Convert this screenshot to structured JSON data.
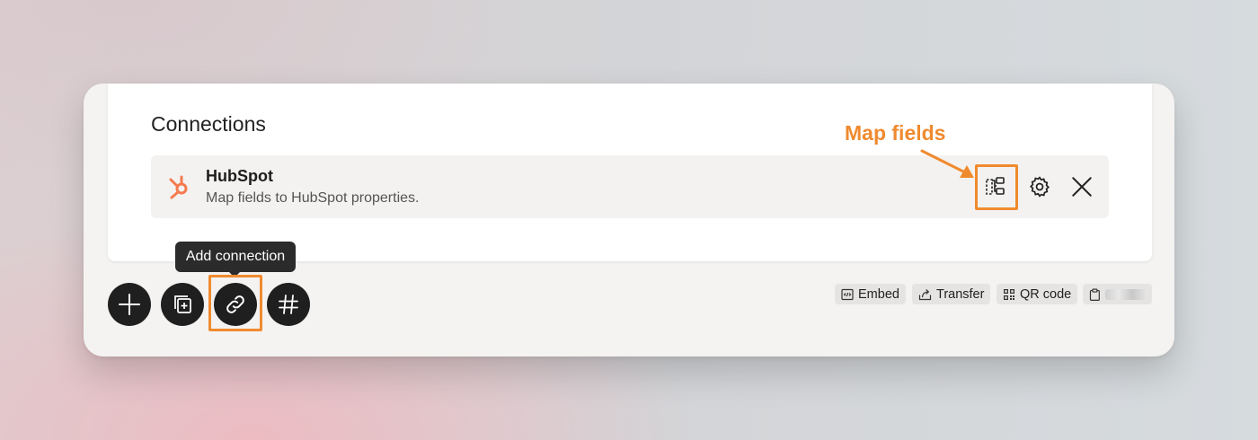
{
  "section": {
    "title": "Connections"
  },
  "connection": {
    "name": "HubSpot",
    "description": "Map fields to HubSpot properties.",
    "icon": "hubspot-logo-icon",
    "brand_color": "#f57b4f",
    "actions": {
      "map_fields_icon": "map-fields-icon",
      "settings_icon": "gear-icon",
      "remove_icon": "close-icon"
    }
  },
  "annotation": {
    "label": "Map fields",
    "color": "#f08a2f"
  },
  "tooltip": {
    "label": "Add connection"
  },
  "toolbar": {
    "buttons": [
      "plus-icon",
      "duplicate-icon",
      "link-icon",
      "hash-icon"
    ]
  },
  "share_actions": {
    "embed": "Embed",
    "transfer": "Transfer",
    "qr_code": "QR code"
  }
}
